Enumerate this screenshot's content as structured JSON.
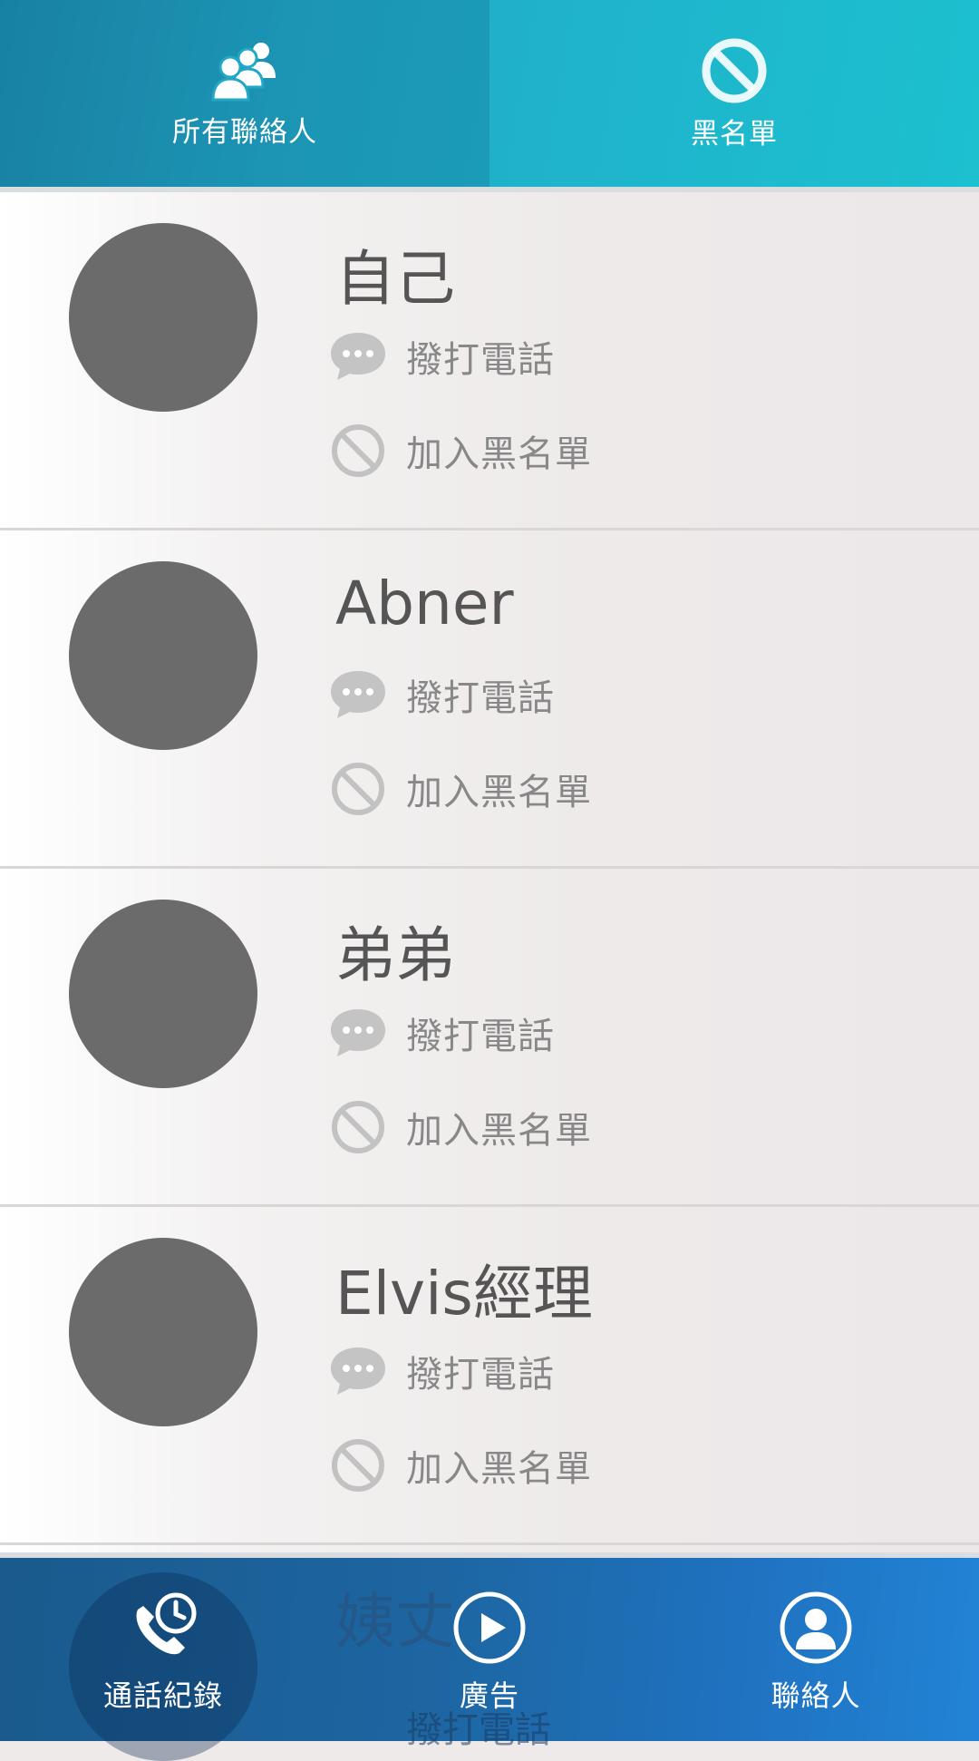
{
  "top_tabs": [
    {
      "label": "所有聯絡人",
      "icon": "contacts-group-icon",
      "active": true
    },
    {
      "label": "黑名單",
      "icon": "block-icon",
      "active": false
    }
  ],
  "contacts": [
    {
      "name": "自己",
      "call_label": "撥打電話",
      "block_label": "加入黑名單"
    },
    {
      "name": "Abner",
      "call_label": "撥打電話",
      "block_label": "加入黑名單"
    },
    {
      "name": "弟弟",
      "call_label": "撥打電話",
      "block_label": "加入黑名單"
    },
    {
      "name": "Elvis經理",
      "call_label": "撥打電話",
      "block_label": "加入黑名單"
    },
    {
      "name": "姨丈",
      "call_label": "撥打電話"
    }
  ],
  "bottom_nav": [
    {
      "label": "通話紀錄",
      "icon": "call-log-icon",
      "active": true
    },
    {
      "label": "廣告",
      "icon": "play-icon",
      "active": false
    },
    {
      "label": "聯絡人",
      "icon": "person-icon",
      "active": false
    }
  ],
  "colors": {
    "top_bar": "#22a8c6",
    "bottom_bar": "#1d66a2",
    "avatar": "#6b6b6b",
    "action_icon": "#c2c2c2"
  }
}
